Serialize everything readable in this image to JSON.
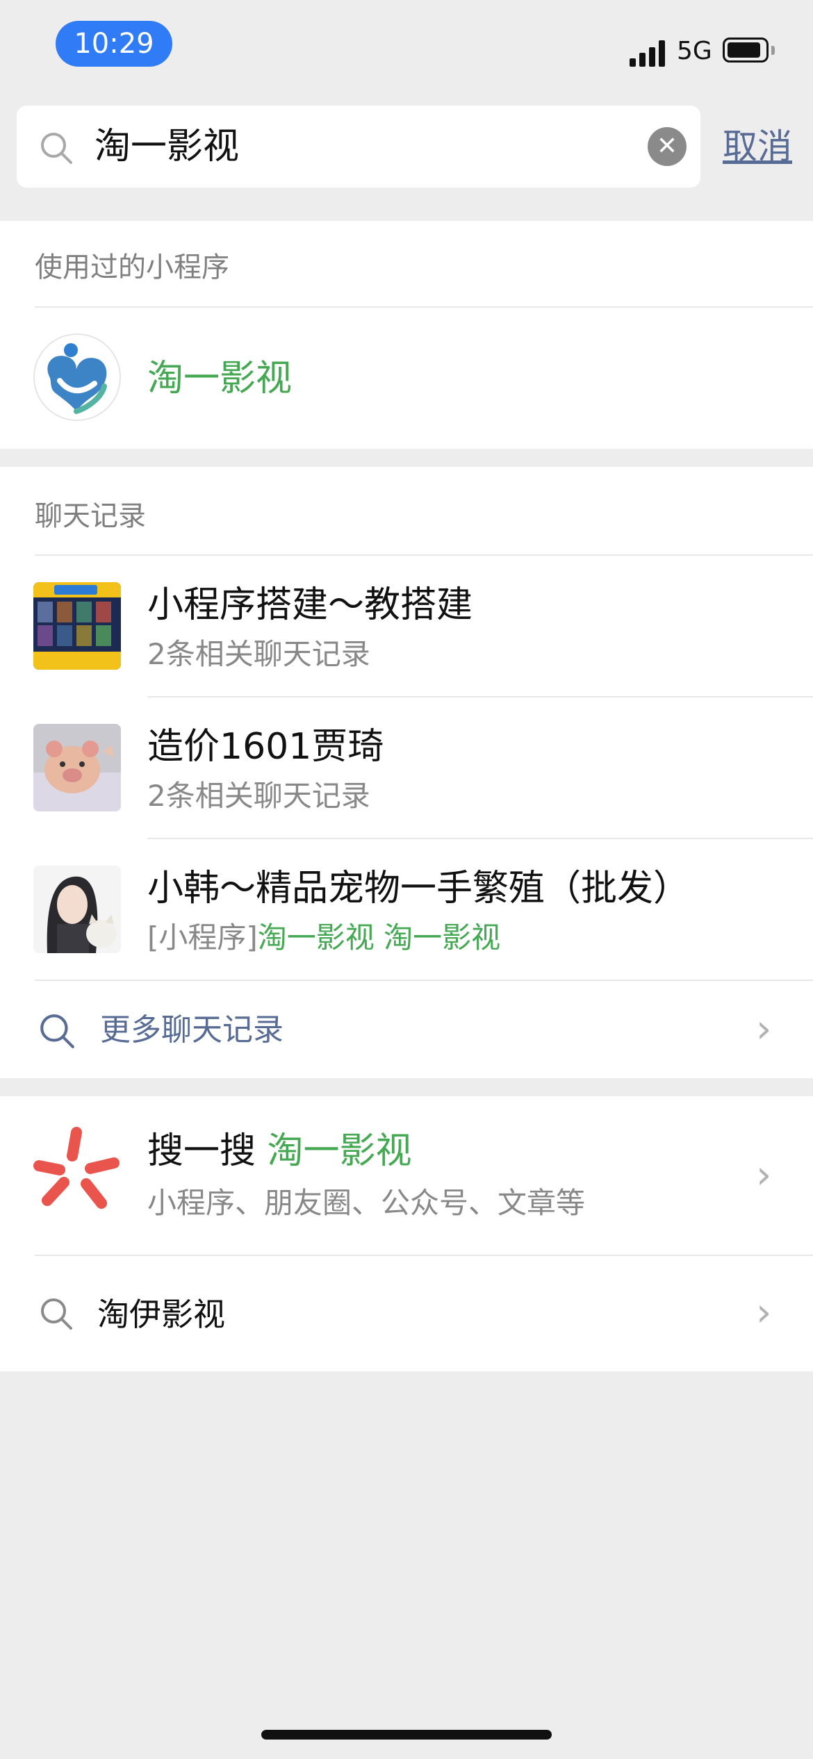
{
  "status_bar": {
    "time": "10:29",
    "network": "5G"
  },
  "search": {
    "value": "淘一影视",
    "cancel_label": "取消"
  },
  "mini_programs": {
    "title": "使用过的小程序",
    "items": [
      {
        "name": "淘一影视"
      }
    ]
  },
  "chats": {
    "title": "聊天记录",
    "items": [
      {
        "name": "小程序搭建～教搭建",
        "sub": "2条相关聊天记录"
      },
      {
        "name": "造价1601贾琦",
        "sub": "2条相关聊天记录"
      },
      {
        "name": "小韩～精品宠物一手繁殖（批发）",
        "sub_prefix": "[小程序]",
        "sub_match": "淘一影视 淘一影视"
      }
    ],
    "more_label": "更多聊天记录"
  },
  "sousou": {
    "prefix": "搜一搜",
    "query": "淘一影视",
    "sub": "小程序、朋友圈、公众号、文章等"
  },
  "suggestion": {
    "label": "淘伊影视"
  },
  "colors": {
    "accent_green": "#45a852",
    "link_blue": "#576b95",
    "sousou_red": "#e9554d",
    "time_pill": "#2f7cf6"
  },
  "icons": [
    "search-icon",
    "clear-icon",
    "chevron-right-icon",
    "sousou-icon",
    "signal-icon",
    "battery-icon"
  ]
}
